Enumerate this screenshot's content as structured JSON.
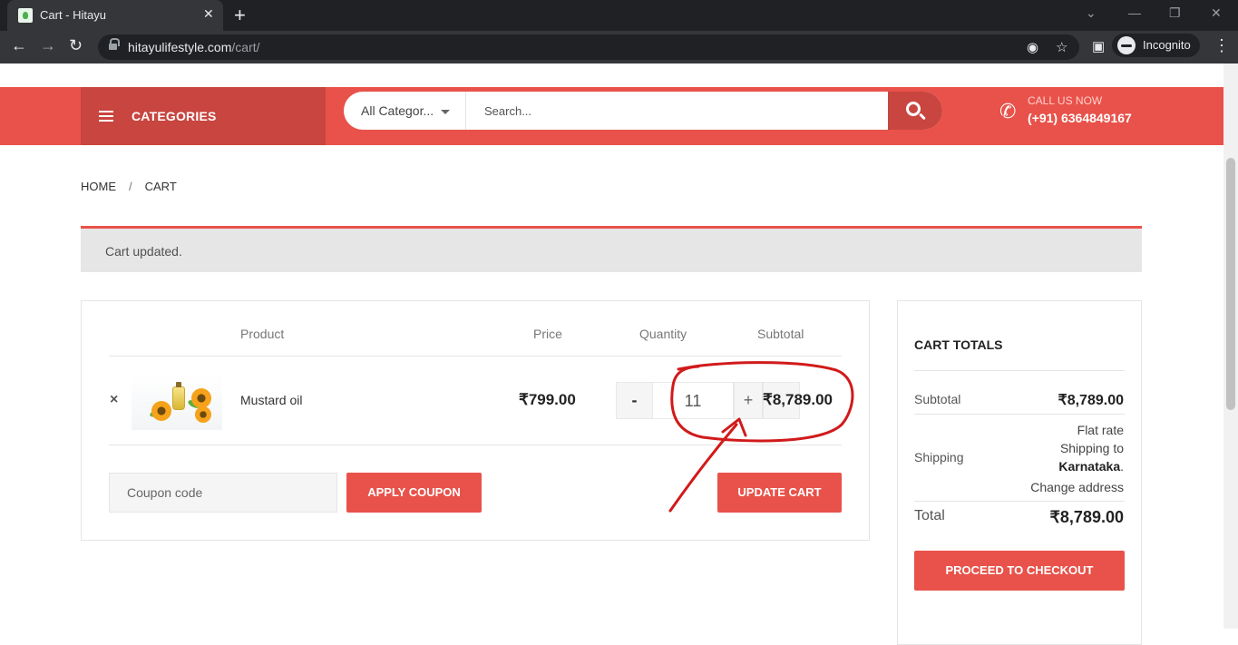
{
  "browser": {
    "tab_title": "Cart - Hitayu",
    "url_host": "hitayulifestyle.com",
    "url_path": "/cart/",
    "incognito_label": "Incognito"
  },
  "header": {
    "categories_label": "CATEGORIES",
    "category_select": "All Categor...",
    "search_placeholder": "Search...",
    "call_label": "CALL US NOW",
    "call_number": "(+91) 6364849167"
  },
  "breadcrumb": {
    "home": "HOME",
    "separator": "/",
    "current": "CART"
  },
  "notice": "Cart updated.",
  "cart": {
    "headers": {
      "product": "Product",
      "price": "Price",
      "quantity": "Quantity",
      "subtotal": "Subtotal"
    },
    "items": [
      {
        "remove": "×",
        "name": "Mustard oil",
        "price": "₹799.00",
        "quantity": "11",
        "minus": "-",
        "plus": "+",
        "subtotal": "₹8,789.00"
      }
    ],
    "coupon_placeholder": "Coupon code",
    "apply_coupon": "APPLY COUPON",
    "update_cart": "UPDATE CART"
  },
  "totals": {
    "title": "CART TOTALS",
    "subtotal_label": "Subtotal",
    "subtotal_value": "₹8,789.00",
    "shipping_label": "Shipping",
    "shipping_method": "Flat rate",
    "shipping_to": "Shipping to",
    "shipping_region": "Karnataka",
    "change_address": "Change address",
    "total_label": "Total",
    "total_value": "₹8,789.00",
    "checkout": "PROCEED TO CHECKOUT"
  },
  "colors": {
    "brand_red": "#e8524a",
    "brand_dark_red": "#c9453f",
    "annotation_red": "#d11a1a"
  }
}
